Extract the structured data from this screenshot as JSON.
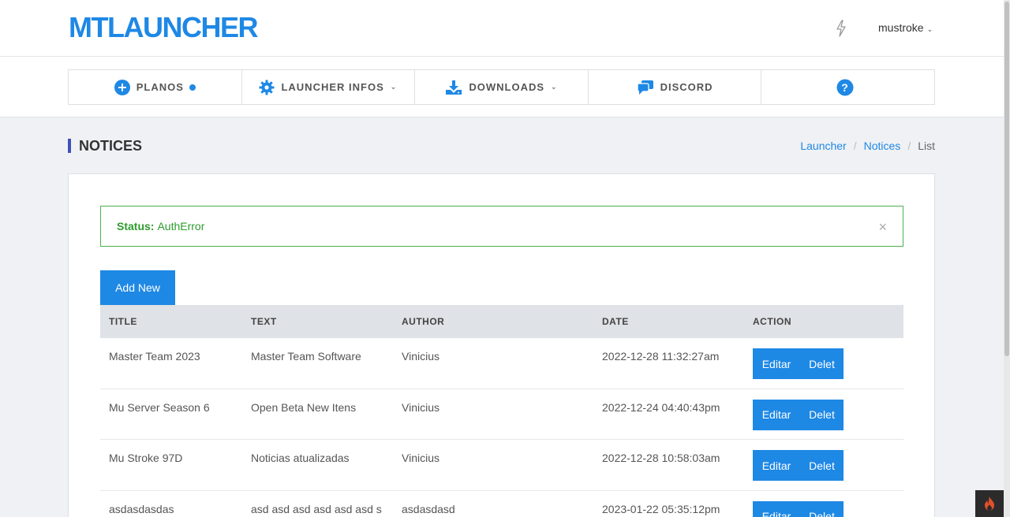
{
  "header": {
    "logo": "MTLAUNCHER",
    "user": "mustroke"
  },
  "nav": [
    {
      "label": "PLANOS"
    },
    {
      "label": "LAUNCHER INFOS"
    },
    {
      "label": "DOWNLOADS"
    },
    {
      "label": "DISCORD"
    },
    {
      "label": ""
    }
  ],
  "page": {
    "title": "NOTICES",
    "breadcrumb": [
      "Launcher",
      "Notices",
      "List"
    ]
  },
  "alert": {
    "label": "Status:",
    "value": "AuthError",
    "close": "×"
  },
  "add_button": "Add New",
  "table": {
    "headers": [
      "TITLE",
      "TEXT",
      "AUTHOR",
      "DATE",
      "ACTION"
    ],
    "rows": [
      {
        "title": "Master Team 2023",
        "text": "Master Team Software",
        "author": "Vinicius",
        "date": "2022-12-28 11:32:27am"
      },
      {
        "title": "Mu Server Season 6",
        "text": "Open Beta New Itens",
        "author": "Vinicius",
        "date": "2022-12-24 04:40:43pm"
      },
      {
        "title": "Mu Stroke 97D",
        "text": "Noticias atualizadas",
        "author": "Vinicius",
        "date": "2022-12-28 10:58:03am"
      },
      {
        "title": "asdasdasdas",
        "text": "asd asd asd asd asd asd s",
        "author": "asdasdasd",
        "date": "2023-01-22 05:35:12pm"
      }
    ],
    "edit_label": "Editar",
    "delete_label": "Delet"
  },
  "colors": {
    "primary": "#1e88e5",
    "success": "#4caf50",
    "accent_bar": "#3f51b5"
  }
}
